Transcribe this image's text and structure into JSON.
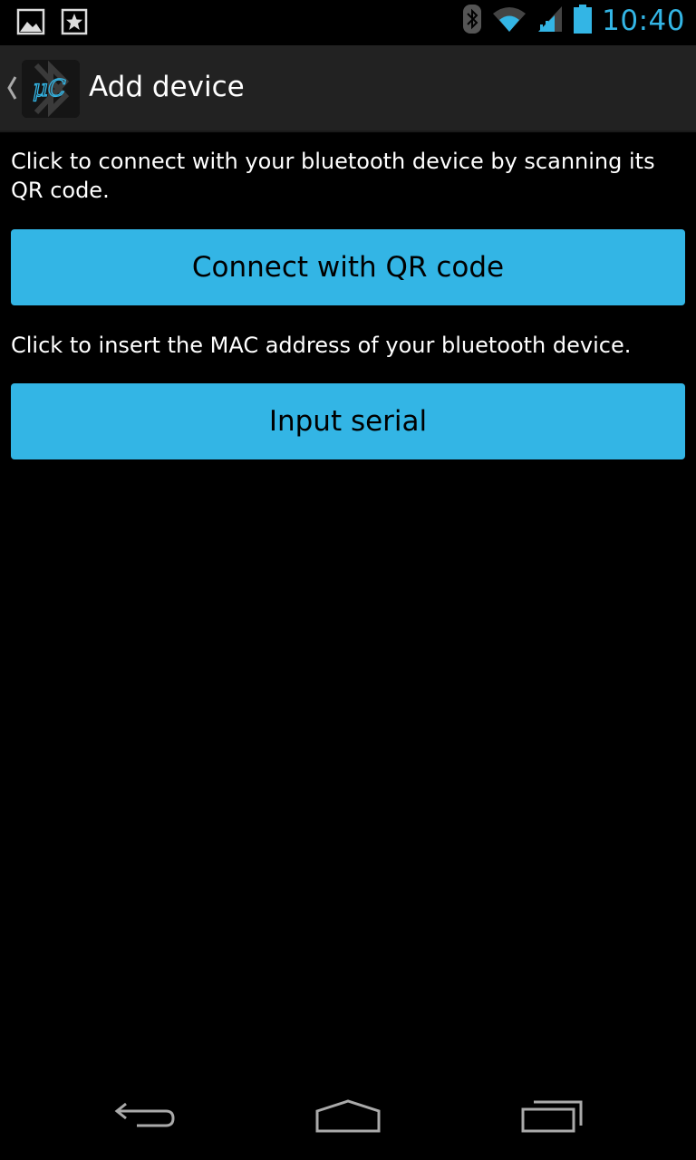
{
  "status_bar": {
    "time": "10:40",
    "icons": [
      "gallery-icon",
      "starred-notification-icon",
      "bluetooth-icon",
      "wifi-icon",
      "signal-icon",
      "battery-icon"
    ],
    "accent_color": "#33b5e5"
  },
  "action_bar": {
    "title": "Add device",
    "logo_text": "μC",
    "icons": [
      "up-caret-icon",
      "app-logo-icon"
    ]
  },
  "main": {
    "qr_description": "Click to connect with your bluetooth device by scanning its QR code.",
    "qr_button_label": "Connect with QR code",
    "serial_description": "Click to insert the MAC address of your bluetooth device.",
    "serial_button_label": "Input serial",
    "button_color": "#33b5e5"
  },
  "nav_bar": {
    "icons": [
      "back-icon",
      "home-icon",
      "recent-apps-icon"
    ]
  }
}
